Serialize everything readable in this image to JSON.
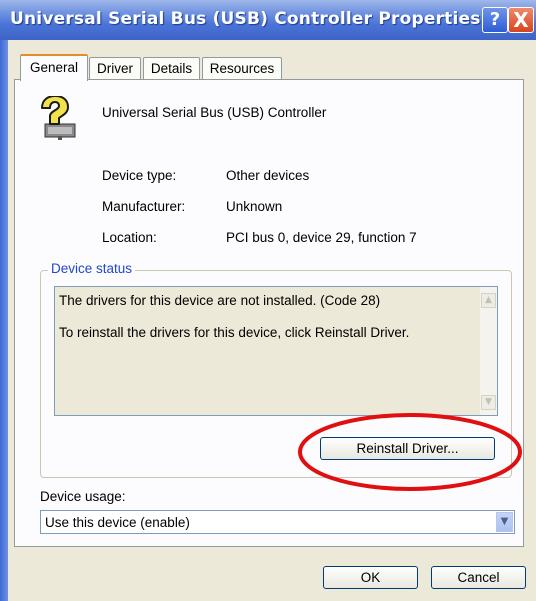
{
  "window": {
    "title": "Universal Serial Bus (USB) Controller Properties",
    "help_button": "?",
    "close_button": "X"
  },
  "tabs": [
    {
      "label": "General"
    },
    {
      "label": "Driver"
    },
    {
      "label": "Details"
    },
    {
      "label": "Resources"
    }
  ],
  "device": {
    "name": "Universal Serial Bus (USB) Controller",
    "icon": "unknown-device-question-icon",
    "properties": [
      {
        "label": "Device type:",
        "value": "Other devices"
      },
      {
        "label": "Manufacturer:",
        "value": "Unknown"
      },
      {
        "label": "Location:",
        "value": "PCI bus 0, device 29, function 7"
      }
    ]
  },
  "status_group": {
    "label": "Device status",
    "lines": [
      "The drivers for this device are not installed. (Code 28)",
      "To reinstall the drivers for this device, click Reinstall Driver."
    ],
    "reinstall_button": "Reinstall Driver..."
  },
  "usage": {
    "label": "Device usage:",
    "selected": "Use this device (enable)"
  },
  "footer": {
    "ok": "OK",
    "cancel": "Cancel"
  },
  "colors": {
    "title_bar": "#4c74d8",
    "group_label": "#1f48cc",
    "annotation_ellipse": "#e01010",
    "active_tab_accent": "#e68b2c"
  }
}
